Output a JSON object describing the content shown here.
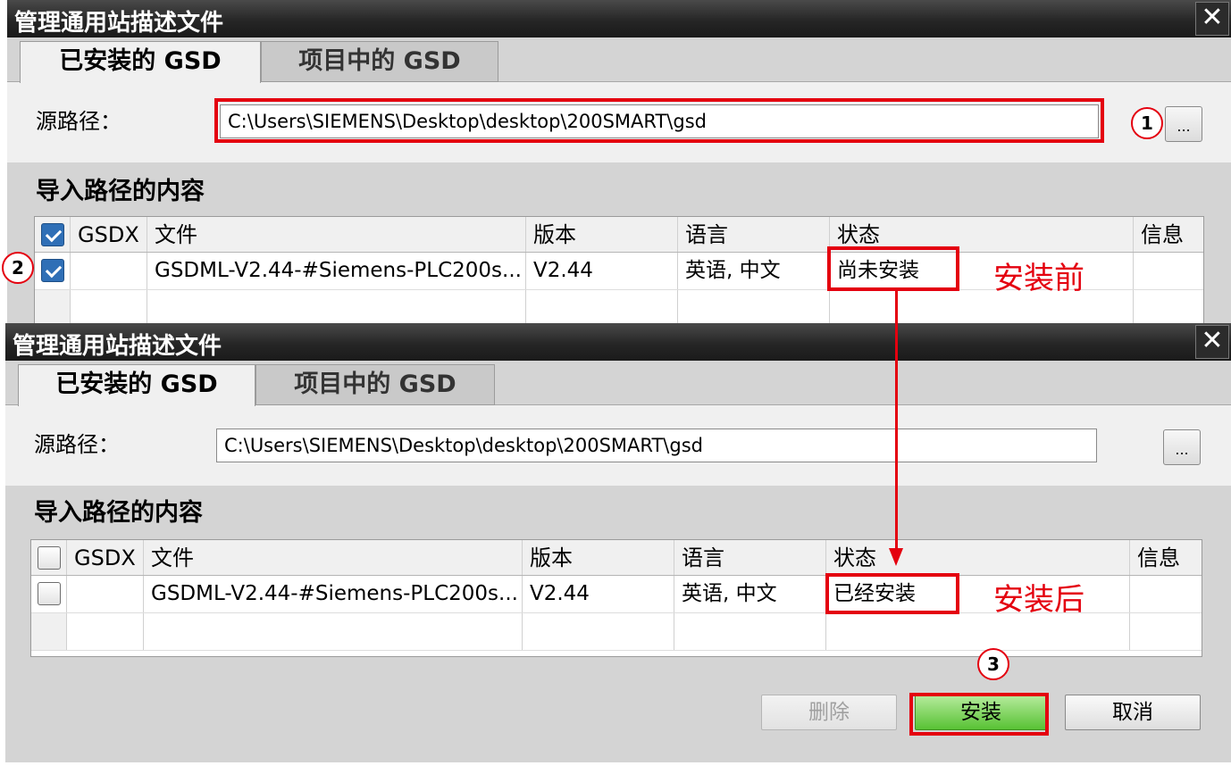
{
  "dialog_before": {
    "title": "管理通用站描述文件",
    "tabs": [
      {
        "label": "已安装的 GSD",
        "active": true
      },
      {
        "label": "项目中的 GSD",
        "active": false
      }
    ],
    "source_path_label": "源路径：",
    "source_path_value": "C:\\Users\\SIEMENS\\Desktop\\desktop\\200SMART\\gsd",
    "browse_label": "...",
    "content_label": "导入路径的内容",
    "columns": [
      "GSDX",
      "文件",
      "版本",
      "语言",
      "状态",
      "信息"
    ],
    "header_checkbox_checked": true,
    "rows": [
      {
        "checked": true,
        "gsdx": "",
        "file": "GSDML-V2.44-#Siemens-PLC200s...",
        "version": "V2.44",
        "language": "英语, 中文",
        "status": "尚未安装",
        "info": ""
      }
    ]
  },
  "dialog_after": {
    "title": "管理通用站描述文件",
    "tabs": [
      {
        "label": "已安装的 GSD",
        "active": true
      },
      {
        "label": "项目中的 GSD",
        "active": false
      }
    ],
    "source_path_label": "源路径：",
    "source_path_value": "C:\\Users\\SIEMENS\\Desktop\\desktop\\200SMART\\gsd",
    "browse_label": "...",
    "content_label": "导入路径的内容",
    "columns": [
      "GSDX",
      "文件",
      "版本",
      "语言",
      "状态",
      "信息"
    ],
    "header_checkbox_checked": false,
    "rows": [
      {
        "checked": false,
        "gsdx": "",
        "file": "GSDML-V2.44-#Siemens-PLC200s...",
        "version": "V2.44",
        "language": "英语, 中文",
        "status": "已经安装",
        "info": ""
      }
    ],
    "buttons": {
      "delete": "删除",
      "install": "安装",
      "cancel": "取消"
    }
  },
  "annotations": {
    "before_text": "安装前",
    "after_text": "安装后",
    "step1": "1",
    "step2": "2",
    "step3": "3",
    "color": "#e4000f"
  },
  "colors": {
    "titlebar": "#262626",
    "dialog_bg": "#d4d4d4",
    "install_button": "#58c234",
    "checkbox_checked": "#2f6fb6"
  }
}
